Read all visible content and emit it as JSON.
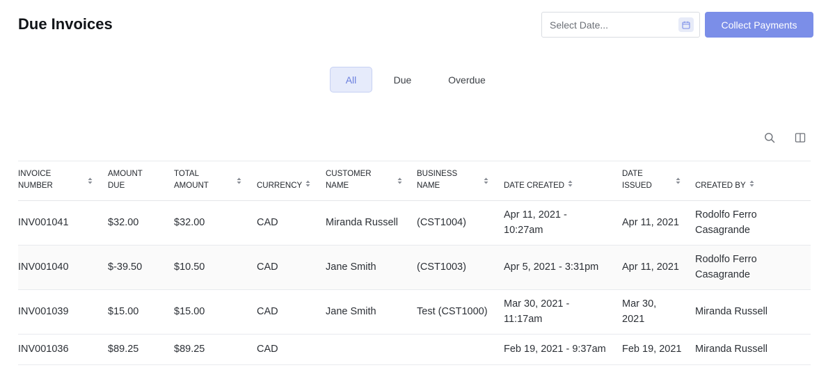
{
  "header": {
    "title": "Due Invoices",
    "date_placeholder": "Select Date...",
    "collect_label": "Collect Payments"
  },
  "tabs": [
    {
      "label": "All",
      "active": true
    },
    {
      "label": "Due",
      "active": false
    },
    {
      "label": "Overdue",
      "active": false
    }
  ],
  "toolbar": {
    "search_icon": "search-icon",
    "columns_icon": "columns-icon"
  },
  "table": {
    "columns": [
      {
        "line1": "INVOICE",
        "line2": "NUMBER"
      },
      {
        "line1": "AMOUNT",
        "line2": "DUE"
      },
      {
        "line1": "TOTAL",
        "line2": "AMOUNT"
      },
      {
        "line1": "",
        "line2": "CURRENCY"
      },
      {
        "line1": "CUSTOMER",
        "line2": "NAME"
      },
      {
        "line1": "BUSINESS",
        "line2": "NAME"
      },
      {
        "line1": "",
        "line2": "DATE CREATED"
      },
      {
        "line1": "DATE",
        "line2": "ISSUED"
      },
      {
        "line1": "",
        "line2": "CREATED BY"
      }
    ],
    "rows": [
      {
        "invoice": "INV001041",
        "amount_due": "$32.00",
        "total": "$32.00",
        "currency": "CAD",
        "customer": "Miranda Russell",
        "business": "(CST1004)",
        "created_1": "Apr 11, 2021 -",
        "created_2": "10:27am",
        "issued_1": "Apr 11, 2021",
        "issued_2": "",
        "by_1": "Rodolfo Ferro",
        "by_2": "Casagrande"
      },
      {
        "invoice": "INV001040",
        "amount_due": "$-39.50",
        "total": "$10.50",
        "currency": "CAD",
        "customer": "Jane Smith",
        "business": "(CST1003)",
        "created_1": "Apr 5, 2021 - 3:31pm",
        "created_2": "",
        "issued_1": "Apr 11, 2021",
        "issued_2": "",
        "by_1": "Rodolfo Ferro",
        "by_2": "Casagrande"
      },
      {
        "invoice": "INV001039",
        "amount_due": "$15.00",
        "total": "$15.00",
        "currency": "CAD",
        "customer": "Jane Smith",
        "business": "Test (CST1000)",
        "created_1": "Mar 30, 2021 -",
        "created_2": "11:17am",
        "issued_1": "Mar 30,",
        "issued_2": "2021",
        "by_1": "Miranda Russell",
        "by_2": ""
      },
      {
        "invoice": "INV001036",
        "amount_due": "$89.25",
        "total": "$89.25",
        "currency": "CAD",
        "customer": "",
        "business": "",
        "created_1": "Feb 19, 2021 - 9:37am",
        "created_2": "",
        "issued_1": "Feb 19, 2021",
        "issued_2": "",
        "by_1": "Miranda Russell",
        "by_2": ""
      }
    ]
  },
  "colors": {
    "accent": "#7b8ee8",
    "tab_active_bg": "#e6ebfb",
    "tab_active_text": "#6b7fde"
  }
}
